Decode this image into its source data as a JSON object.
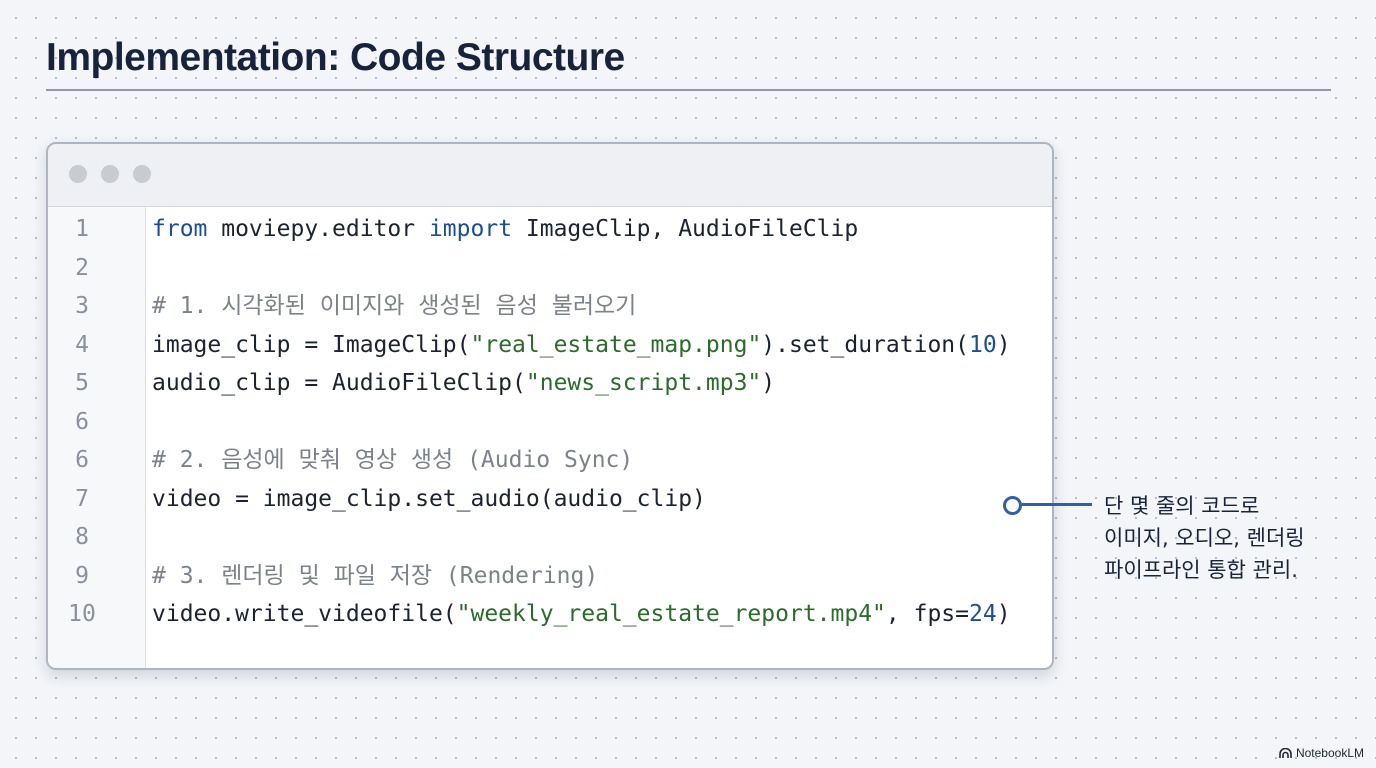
{
  "slide": {
    "title": "Implementation: Code Structure"
  },
  "code": {
    "lines": [
      {
        "no": "1",
        "segments": [
          {
            "t": "from",
            "c": "kw"
          },
          {
            "t": " moviepy.editor ",
            "c": ""
          },
          {
            "t": "import",
            "c": "kw"
          },
          {
            "t": " ImageClip, AudioFileClip",
            "c": ""
          }
        ]
      },
      {
        "no": "2",
        "segments": []
      },
      {
        "no": "3",
        "segments": [
          {
            "t": "# 1. 시각화된 이미지와 생성된 음성 불러오기",
            "c": "cmt"
          }
        ]
      },
      {
        "no": "4",
        "segments": [
          {
            "t": "image_clip = ImageClip(",
            "c": ""
          },
          {
            "t": "\"real_estate_map.png\"",
            "c": "str"
          },
          {
            "t": ").set_duration(",
            "c": ""
          },
          {
            "t": "10",
            "c": "num"
          },
          {
            "t": ")",
            "c": ""
          }
        ]
      },
      {
        "no": "5",
        "segments": [
          {
            "t": "audio_clip = AudioFileClip(",
            "c": ""
          },
          {
            "t": "\"news_script.mp3\"",
            "c": "str"
          },
          {
            "t": ")",
            "c": ""
          }
        ]
      },
      {
        "no": "6",
        "segments": []
      },
      {
        "no": "6",
        "segments": [
          {
            "t": "# 2. 음성에 맞춰 영상 생성 (Audio Sync)",
            "c": "cmt"
          }
        ]
      },
      {
        "no": "7",
        "segments": [
          {
            "t": "video = image_clip.set_audio(audio_clip)",
            "c": ""
          }
        ]
      },
      {
        "no": "8",
        "segments": []
      },
      {
        "no": "9",
        "segments": [
          {
            "t": "# 3. 렌더링 및 파일 저장 (Rendering)",
            "c": "cmt"
          }
        ]
      },
      {
        "no": "10",
        "segments": [
          {
            "t": "video.write_videofile(",
            "c": ""
          },
          {
            "t": "\"weekly_real_estate_report.mp4\"",
            "c": "str"
          },
          {
            "t": ", fps=",
            "c": ""
          },
          {
            "t": "24",
            "c": "num"
          },
          {
            "t": ")",
            "c": ""
          }
        ]
      }
    ]
  },
  "callout": {
    "lines": [
      "단 몇 줄의 코드로",
      "이미지, 오디오, 렌더링",
      "파이프라인 통합 관리."
    ]
  },
  "branding": {
    "label": "NotebookLM",
    "icon": "notebooklm-logo-icon"
  }
}
